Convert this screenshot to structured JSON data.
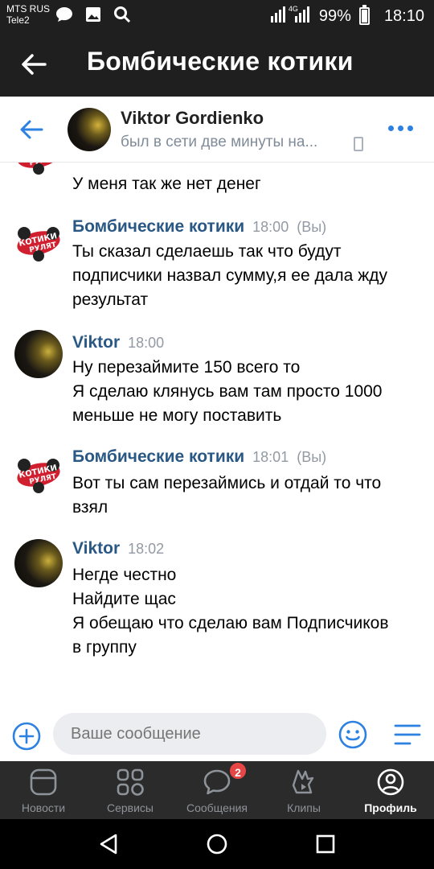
{
  "status_bar": {
    "carrier_1": "MTS RUS",
    "carrier_2": "Tele2",
    "network": "4G",
    "battery": "99%",
    "time": "18:10"
  },
  "app_header": {
    "title": "Бомбические котики"
  },
  "chat_header": {
    "name": "Viktor Gordienko",
    "status": "был в сети две минуты на..."
  },
  "messages": [
    {
      "author": "",
      "time": "",
      "lines": [
        "У меня так же нет денег"
      ]
    },
    {
      "author": "Бомбические котики",
      "time": "18:00",
      "you": "(Вы)",
      "lines": [
        "Ты сказал сделаешь так что будут",
        "подписчики назвал сумму,я ее дала жду",
        "результат"
      ]
    },
    {
      "author": "Viktor",
      "time": "18:00",
      "lines": [
        "Ну перезаймите 150 всего то",
        "Я сделаю клянусь вам там просто 1000",
        "меньше не могу поставить"
      ]
    },
    {
      "author": "Бомбические котики",
      "time": "18:01",
      "you": "(Вы)",
      "lines": [
        "Вот ты сам перезаймись и отдай то что",
        "взял"
      ]
    },
    {
      "author": "Viktor",
      "time": "18:02",
      "lines": [
        "Негде честно",
        "Найдите щас",
        "Я обещаю что сделаю вам Подписчиков",
        "в группу"
      ]
    }
  ],
  "avatar_text": "КОТИКИ РУЛЯТ",
  "composer": {
    "placeholder": "Ваше сообщение"
  },
  "tabs": [
    {
      "label": "Новости",
      "icon": "news-icon"
    },
    {
      "label": "Сервисы",
      "icon": "services-icon"
    },
    {
      "label": "Сообщения",
      "icon": "messages-icon",
      "badge": "2"
    },
    {
      "label": "Клипы",
      "icon": "clips-icon"
    },
    {
      "label": "Профиль",
      "icon": "profile-icon",
      "active": true
    }
  ],
  "colors": {
    "accent": "#2d81e0",
    "author": "#2a5885",
    "dark_bar": "#1f1f1f",
    "tab_bar": "#2b2b2b",
    "badge": "#e64646"
  }
}
